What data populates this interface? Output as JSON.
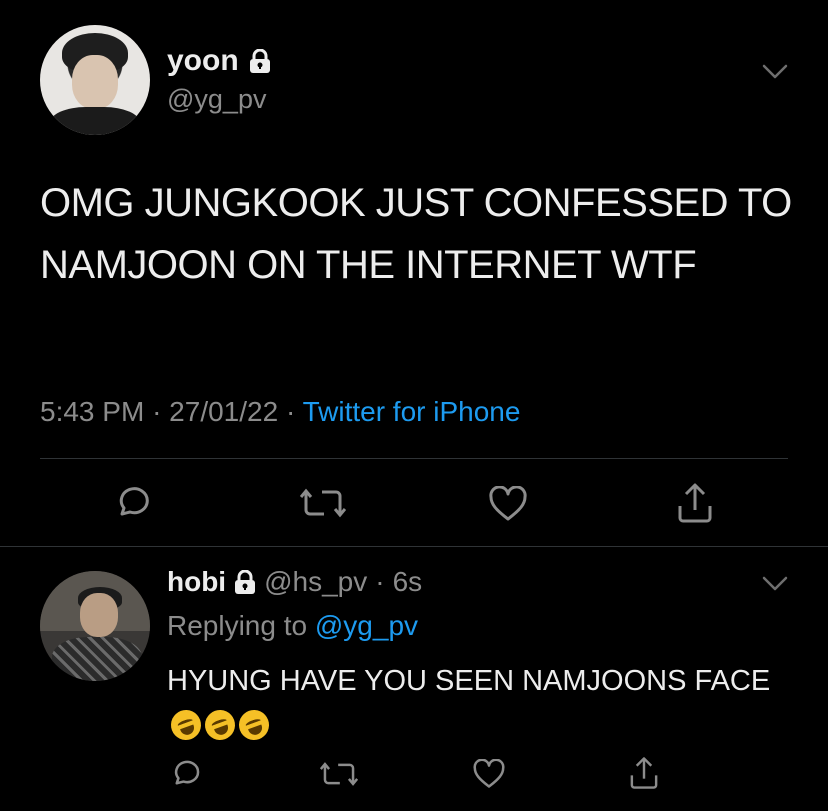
{
  "tweet": {
    "display_name": "yoon",
    "handle": "@yg_pv",
    "text": "OMG JUNGKOOK JUST CONFESSED TO NAMJOON ON THE INTERNET WTF",
    "time": "5:43 PM",
    "date": "27/01/22",
    "separator": "·",
    "source": "Twitter for iPhone"
  },
  "reply": {
    "display_name": "hobi",
    "handle": "@hs_pv",
    "separator": "·",
    "age": "6s",
    "replying_prefix": "Replying to",
    "replying_to": "@yg_pv",
    "text": "HYUNG HAVE YOU SEEN NAMJOONS FACE"
  },
  "icons": {
    "reply": "speech-bubble-icon",
    "retweet": "retweet-icon",
    "like": "heart-icon",
    "share": "share-icon",
    "lock": "lock-icon",
    "more": "chevron-down-icon",
    "emoji": "rolling-on-floor-laughing-emoji"
  },
  "colors": {
    "background": "#000000",
    "text": "#ededed",
    "muted": "#8c8c8c",
    "link": "#1d9bf0",
    "divider": "#2f3336"
  }
}
